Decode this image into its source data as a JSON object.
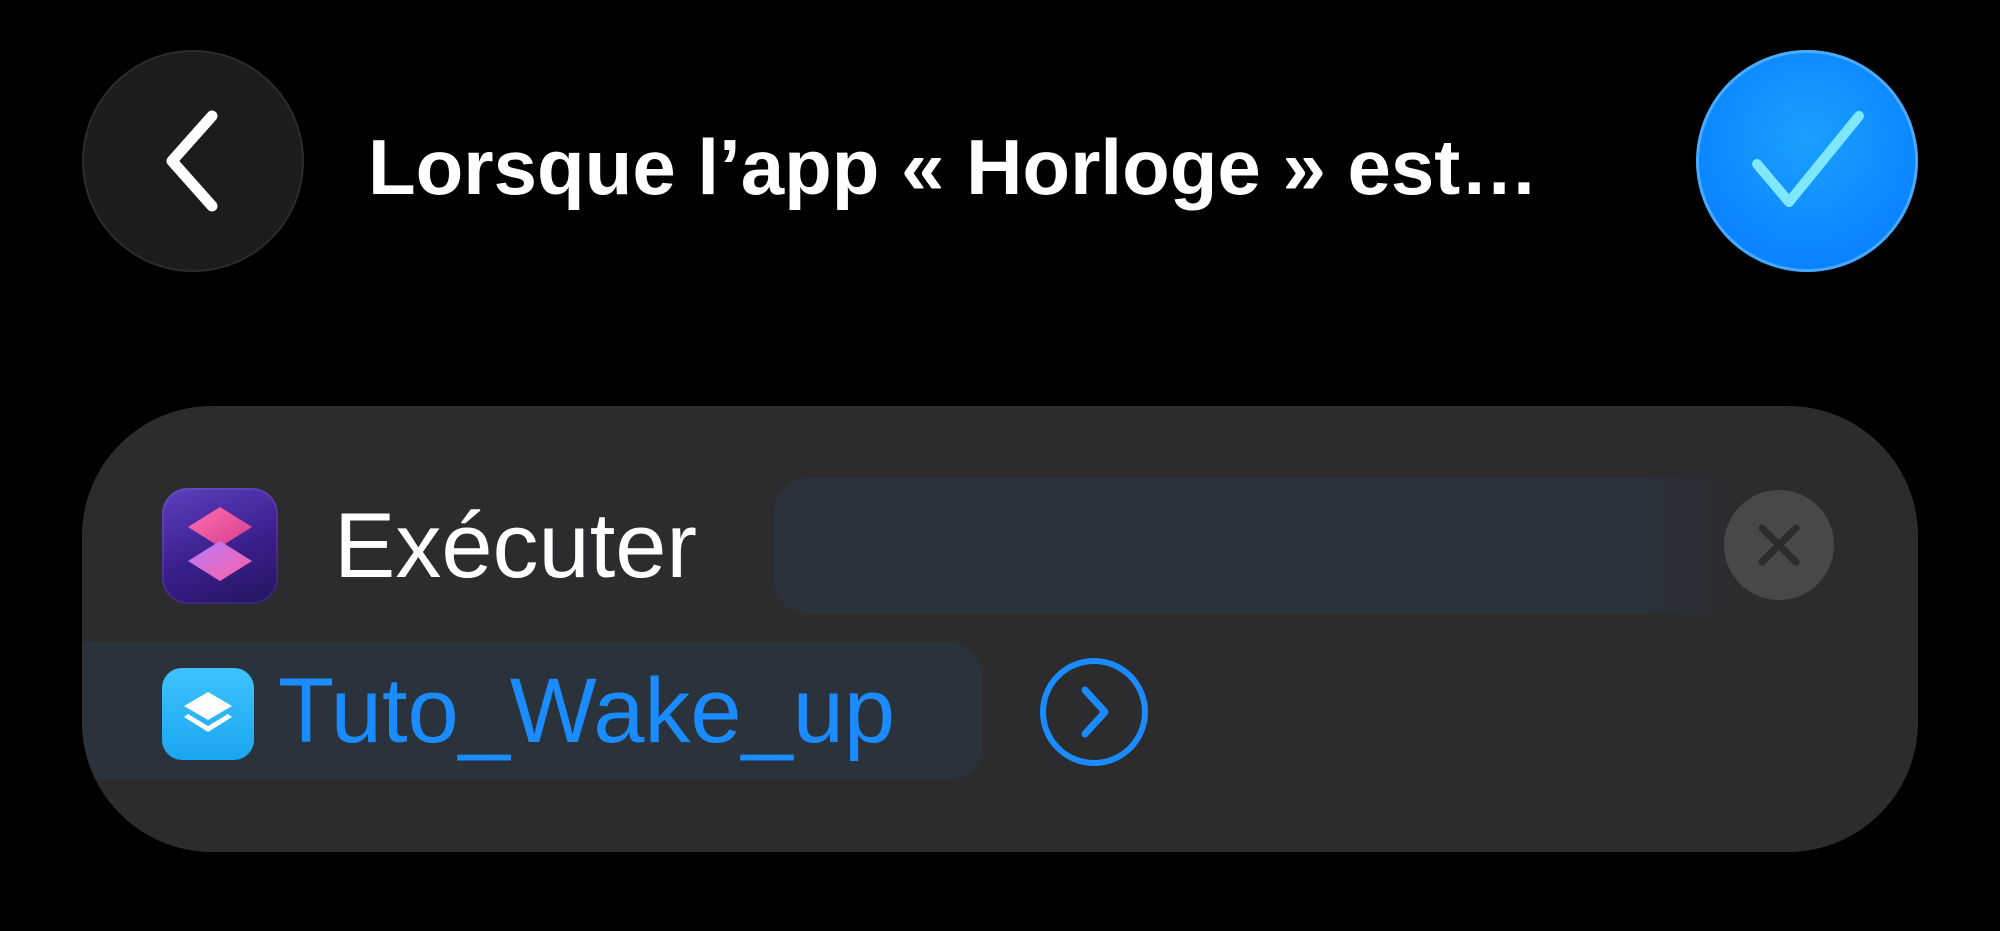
{
  "header": {
    "title": "Lorsque l’app « Horloge » est…",
    "back_icon": "chevron-left-icon",
    "done_icon": "checkmark-icon"
  },
  "action": {
    "app_icon": "shortcuts-app-icon",
    "verb": "Exécuter",
    "parameter_value": "",
    "remove_icon": "xmark-icon",
    "shortcut": {
      "icon": "layers-stack-icon",
      "name": "Tuto_Wake_up",
      "open_icon": "chevron-right-circle-icon"
    }
  },
  "colors": {
    "background": "#000000",
    "accent": "#0a84ff",
    "link": "#1a8cff",
    "card": "#2c2c2e",
    "field": "#2a323c"
  }
}
